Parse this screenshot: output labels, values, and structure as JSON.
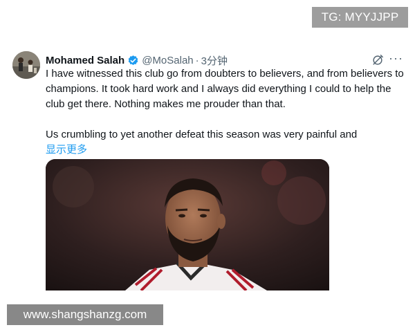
{
  "watermarks": {
    "top_right": "TG: MYYJJPP",
    "bottom_left": "www.shangshanzg.com"
  },
  "tweet": {
    "author_name": "Mohamed Salah",
    "handle": "@MoSalah",
    "separator": "·",
    "time": "3分钟",
    "paragraph_1": "I have witnessed this club go from doubters to believers, and from believers to champions. It took hard work and I always did everything I could to help the club get there. Nothing makes me prouder than that.",
    "paragraph_2": "Us crumbling to yet another defeat this season was very painful and",
    "show_more": "显示更多",
    "more_glyph": "···"
  },
  "colors": {
    "link": "#1d9bf0",
    "verified": "#1d9bf0",
    "secondary_text": "#536471"
  },
  "icons": {
    "verified": "verified-badge-icon",
    "grok": "grok-icon",
    "more": "more-options-icon"
  }
}
